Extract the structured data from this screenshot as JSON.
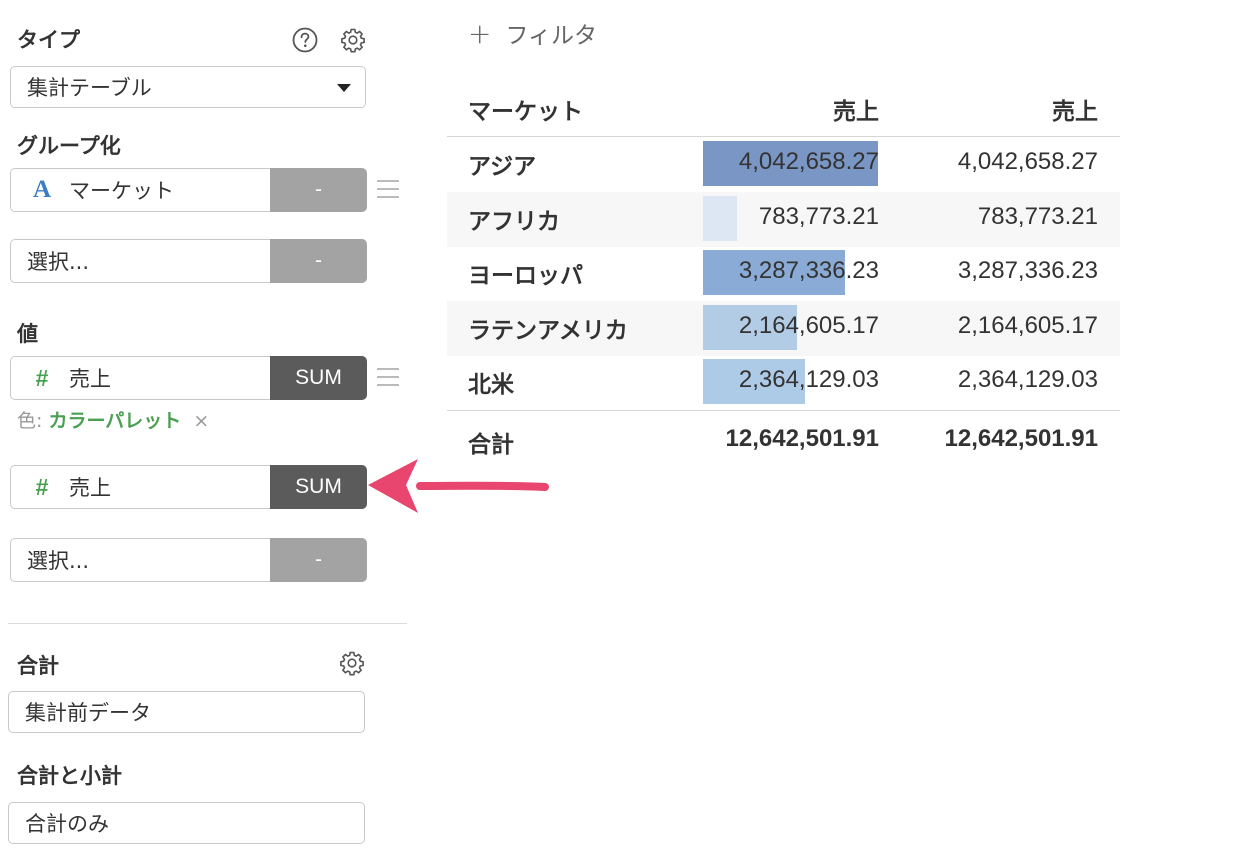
{
  "type_section": {
    "label": "タイプ",
    "selected": "集計テーブル"
  },
  "group_section": {
    "label": "グループ化",
    "field": "マーケット",
    "field_agg": "-",
    "placeholder": "選択...",
    "placeholder_agg": "-"
  },
  "value_section": {
    "label": "値",
    "field1": "売上",
    "field1_agg": "SUM",
    "color_prefix": "色:",
    "color_value": "カラーパレット",
    "color_remove": "×",
    "field2": "売上",
    "field2_agg": "SUM",
    "placeholder": "選択...",
    "placeholder_agg": "-"
  },
  "total_section": {
    "label": "合計",
    "selected": "集計前データ"
  },
  "subtotal_section": {
    "label": "合計と小計",
    "selected": "合計のみ"
  },
  "filter": {
    "plus": "+",
    "label": "フィルタ"
  },
  "table": {
    "headers": [
      "マーケット",
      "売上",
      "売上"
    ],
    "rows": [
      {
        "label": "アジア",
        "v1": "4,042,658.27",
        "v2": "4,042,658.27",
        "ratio": 1.0,
        "color": "#7a96c4"
      },
      {
        "label": "アフリカ",
        "v1": "783,773.21",
        "v2": "783,773.21",
        "ratio": 0.194,
        "color": "#dde6f3"
      },
      {
        "label": "ヨーロッパ",
        "v1": "3,287,336.23",
        "v2": "3,287,336.23",
        "ratio": 0.813,
        "color": "#8aabd5"
      },
      {
        "label": "ラテンアメリカ",
        "v1": "2,164,605.17",
        "v2": "2,164,605.17",
        "ratio": 0.535,
        "color": "#b2cce6"
      },
      {
        "label": "北米",
        "v1": "2,364,129.03",
        "v2": "2,364,129.03",
        "ratio": 0.585,
        "color": "#adcae6"
      }
    ],
    "total_label": "合計",
    "total_v1": "12,642,501.91",
    "total_v2": "12,642,501.91"
  },
  "colors": {
    "arrow": "#e8456f",
    "accent_green": "#4aa052",
    "accent_blue": "#3b7cc7"
  }
}
